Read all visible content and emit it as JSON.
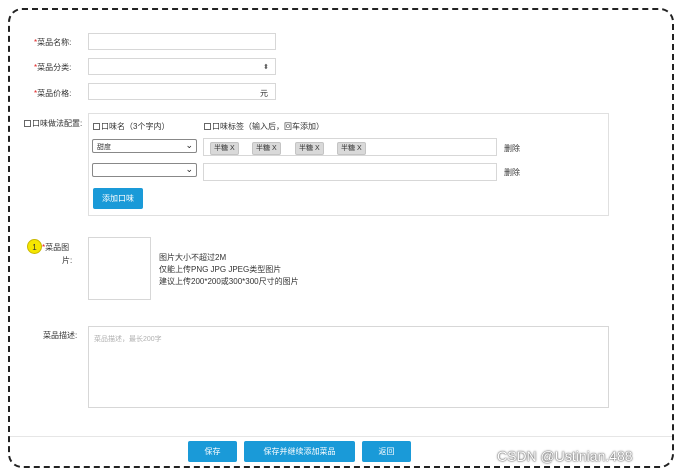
{
  "form": {
    "dish_name": {
      "label": "菜品名称:",
      "value": ""
    },
    "dish_category": {
      "label": "菜品分类:",
      "value": "",
      "arrow": "⬍"
    },
    "dish_price": {
      "label": "菜品价格:",
      "value": "",
      "unit": "元"
    },
    "flavor": {
      "label": "口味做法配置:",
      "name_header": "口味名（3个字内）",
      "tags_header": "口味标签（输入后，回车添加）",
      "rows": [
        {
          "name": "甜度",
          "tags": [
            "半糖 X",
            "半糖 X",
            "半糖 X",
            "半糖 X"
          ],
          "delete": "删除"
        },
        {
          "name": "",
          "tags": [],
          "delete": "删除"
        }
      ],
      "add_button": "添加口味"
    },
    "image": {
      "badge": "1",
      "label_line1": "菜品图",
      "label_line2": "片:",
      "hints": [
        "图片大小不超过2M",
        "仅能上传PNG JPG JPEG类型图片",
        "建议上传200*200或300*300尺寸的图片"
      ]
    },
    "description": {
      "label": "菜品描述:",
      "placeholder": "菜品描述，最长200字"
    }
  },
  "footer": {
    "save": "保存",
    "save_continue": "保存并继续添加菜品",
    "back": "返回"
  },
  "watermark": "CSDN @Ustinian.488",
  "colors": {
    "accent": "#1a9ad8",
    "required": "#e02020",
    "badge": "#f5e600"
  }
}
